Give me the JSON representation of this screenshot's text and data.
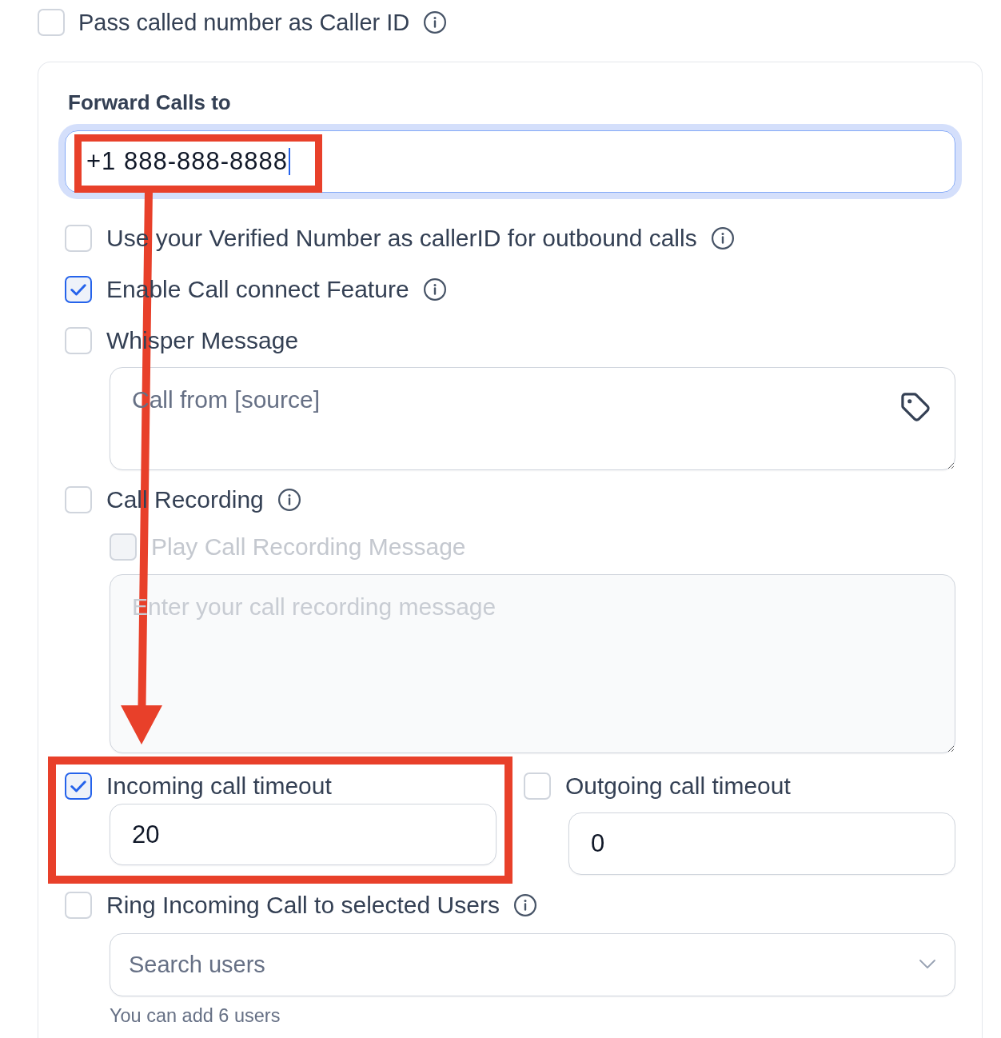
{
  "caller_id_option": {
    "label": "Pass called number as Caller ID",
    "checked": false,
    "info": true
  },
  "forward": {
    "label": "Forward Calls to",
    "value": "+1 888-888-8888",
    "focused": true
  },
  "options": [
    {
      "label": "Use your Verified Number as callerID for outbound calls",
      "checked": false,
      "info": true
    },
    {
      "label": "Enable Call connect Feature",
      "checked": true,
      "info": true
    },
    {
      "label": "Whisper Message",
      "checked": false,
      "info": false,
      "textarea": {
        "placeholder": "Call from [source]",
        "disabled": false,
        "tag_picker": true
      }
    },
    {
      "label": "Call Recording",
      "checked": false,
      "info": true,
      "sub_option": {
        "label": "Play Call Recording Message",
        "checked": false,
        "disabled": true
      },
      "textarea": {
        "placeholder": "Enter your call recording message",
        "disabled": true
      }
    }
  ],
  "timeouts": [
    {
      "label": "Incoming call timeout",
      "checked": true,
      "value": "20"
    },
    {
      "label": "Outgoing call timeout",
      "checked": false,
      "value": "0"
    }
  ],
  "ring_users": {
    "label": "Ring Incoming Call to selected Users",
    "checked": false,
    "info": true,
    "select": {
      "placeholder": "Search users"
    },
    "hint": "You can add 6 users"
  }
}
